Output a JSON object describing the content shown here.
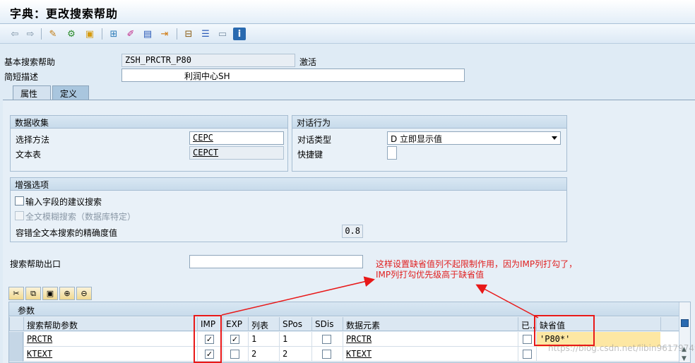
{
  "window": {
    "title": "字典：更改搜索帮助"
  },
  "toolbar": {
    "icons": [
      "back-icon",
      "forward-icon",
      "display-change-icon",
      "activate-icon",
      "check-icon",
      "where-used-icon",
      "hierarchy-icon",
      "pencil-icon",
      "print-icon",
      "transport-icon",
      "tree-icon",
      "align-icon",
      "table-icon",
      "info-icon"
    ]
  },
  "header": {
    "search_help_label": "基本搜索帮助",
    "search_help_value": "ZSH_PRCTR_P80",
    "status": "激活",
    "short_desc_label": "简短描述",
    "short_desc_value": "利润中心SH"
  },
  "tabs": [
    {
      "label": "属性"
    },
    {
      "label": "定义"
    }
  ],
  "data_collection": {
    "title": "数据收集",
    "select_method_label": "选择方法",
    "select_method_value": "CEPC",
    "text_table_label": "文本表",
    "text_table_value": "CEPCT"
  },
  "dialog": {
    "title": "对话行为",
    "type_label": "对话类型",
    "type_value": "D 立即显示值",
    "hotkey_label": "快捷键",
    "hotkey_value": ""
  },
  "enhanced": {
    "title": "增强选项",
    "opt1_label": "输入字段的建议搜索",
    "opt2_label": "全文模糊搜索（数据库特定）",
    "tolerance_label": "容错全文本搜索的精确度值",
    "tolerance_value": "0.8"
  },
  "exit": {
    "label": "搜索帮助出口",
    "value": ""
  },
  "annotation": {
    "line1": "这样设置缺省值列不起限制作用，因为IMP列打勾了，",
    "line2": "IMP列打勾优先级高于缺省值"
  },
  "params": {
    "title": "参数",
    "columns": [
      "搜索帮助参数",
      "IMP",
      "EXP",
      "列表",
      "SPos",
      "SDis",
      "数据元素",
      "已...",
      "缺省值"
    ],
    "rows": [
      {
        "param": "PRCTR",
        "imp": true,
        "exp": true,
        "list": "1",
        "spos": "1",
        "sdis": false,
        "element": "PRCTR",
        "mod": false,
        "default": "'P80*'"
      },
      {
        "param": "KTEXT",
        "imp": true,
        "exp": false,
        "list": "2",
        "spos": "2",
        "sdis": false,
        "element": "KTEXT",
        "mod": false,
        "default": ""
      }
    ]
  },
  "watermark": "https://blog.csdn.net/libin961797495"
}
